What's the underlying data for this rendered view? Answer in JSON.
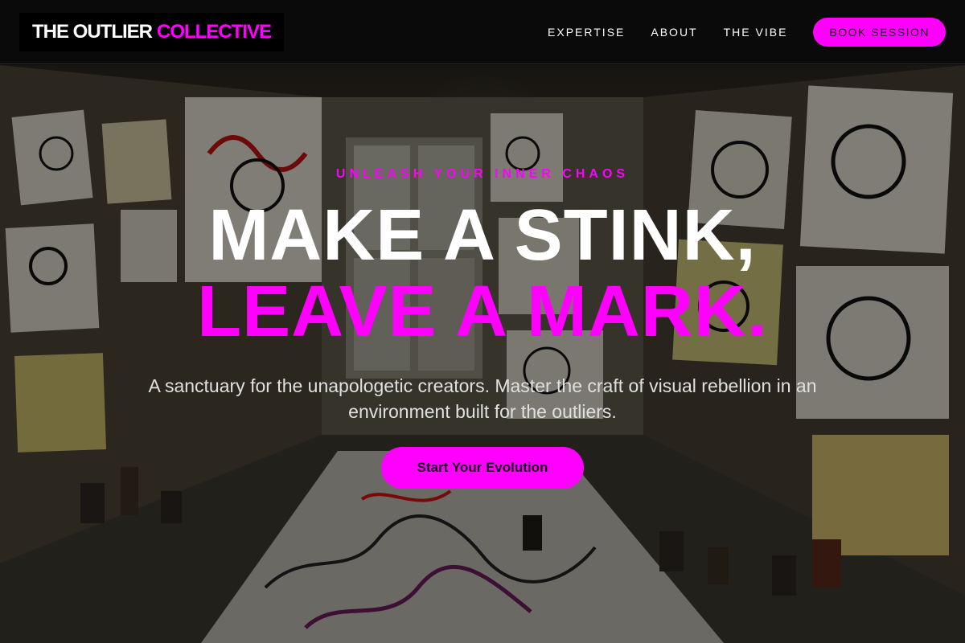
{
  "header": {
    "logo_part1": "THE OUTLIER",
    "logo_part2": "COLLECTIVE",
    "nav": [
      {
        "label": "EXPERTISE"
      },
      {
        "label": "ABOUT"
      },
      {
        "label": "THE VIBE"
      }
    ],
    "cta_label": "BOOK SESSION"
  },
  "hero": {
    "tagline": "UNLEASH YOUR INNER CHAOS",
    "headline_line1": "MAKE A STINK,",
    "headline_line2": "LEAVE A MARK.",
    "subtitle": "A sanctuary for the unapologetic creators. Master the craft of visual rebellion in an environment built for the outliers.",
    "cta_label": "Start Your Evolution",
    "background_image": "art-studio-room-with-doodle-paintings"
  },
  "colors": {
    "accent": "#ff00ff",
    "header_bg": "#0a0a0a",
    "text_primary": "#ffffff"
  }
}
